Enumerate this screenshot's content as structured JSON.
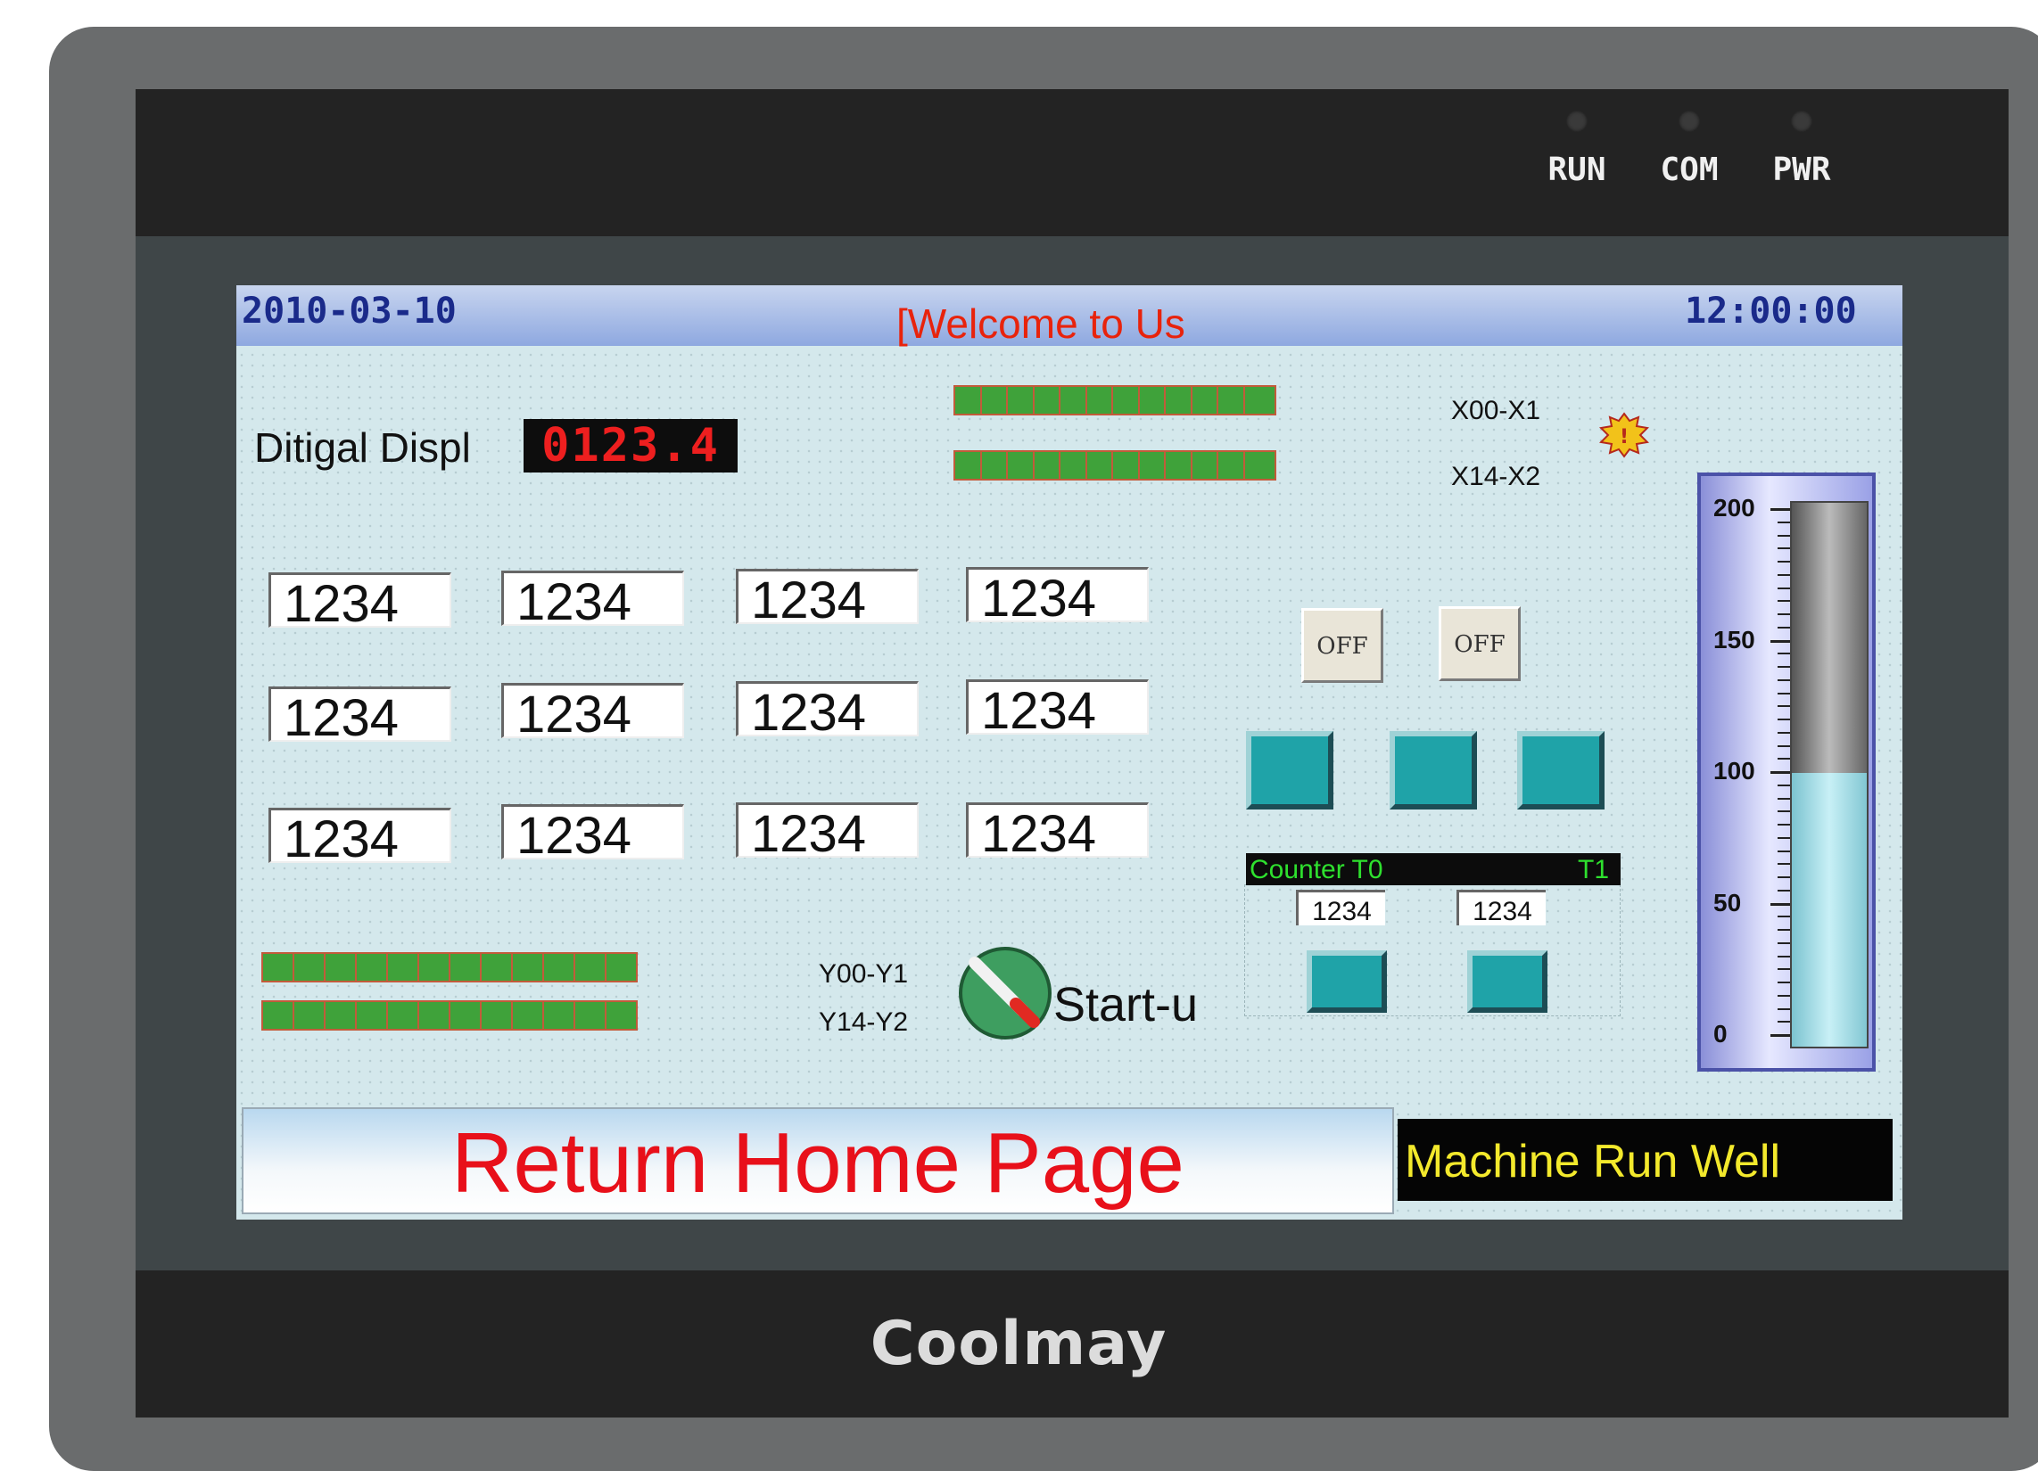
{
  "device": {
    "brand": "Coolmay",
    "indicators": [
      {
        "label": "RUN"
      },
      {
        "label": "COM"
      },
      {
        "label": "PWR"
      }
    ]
  },
  "screen": {
    "title_bar": {
      "date": "2010-03-10",
      "welcome_text": "[Welcome to Us",
      "time": "12:00:00"
    },
    "digital_display": {
      "label": "Ditigal Displ",
      "value": "0123.4"
    },
    "input_lamps": [
      {
        "label": "X00-X1",
        "count": 12
      },
      {
        "label": "X14-X2",
        "count": 12
      }
    ],
    "output_lamps": [
      {
        "label": "Y00-Y1",
        "count": 12
      },
      {
        "label": "Y14-Y2",
        "count": 12
      }
    ],
    "numeric_grid": [
      [
        "1234",
        "1234",
        "1234",
        "1234"
      ],
      [
        "1234",
        "1234",
        "1234",
        "1234"
      ],
      [
        "1234",
        "1234",
        "1234",
        "1234"
      ]
    ],
    "toggle_buttons": [
      "OFF",
      "OFF"
    ],
    "counter": {
      "label_left": "Counter T0",
      "label_right": "T1",
      "values": [
        "1234",
        "1234"
      ]
    },
    "start_switch_label": "Start-u",
    "gauge": {
      "labels": [
        "200",
        "150",
        "100",
        "50",
        "0"
      ],
      "level_fraction": 0.5
    },
    "return_button_label": "Return Home Page",
    "status_text": "Machine Run Well",
    "colors": {
      "screen_bg": "#d4e8ec",
      "lamp_green": "#3fa23a",
      "alarm_text": "#e8230c",
      "status_text": "#f3e92c"
    }
  }
}
